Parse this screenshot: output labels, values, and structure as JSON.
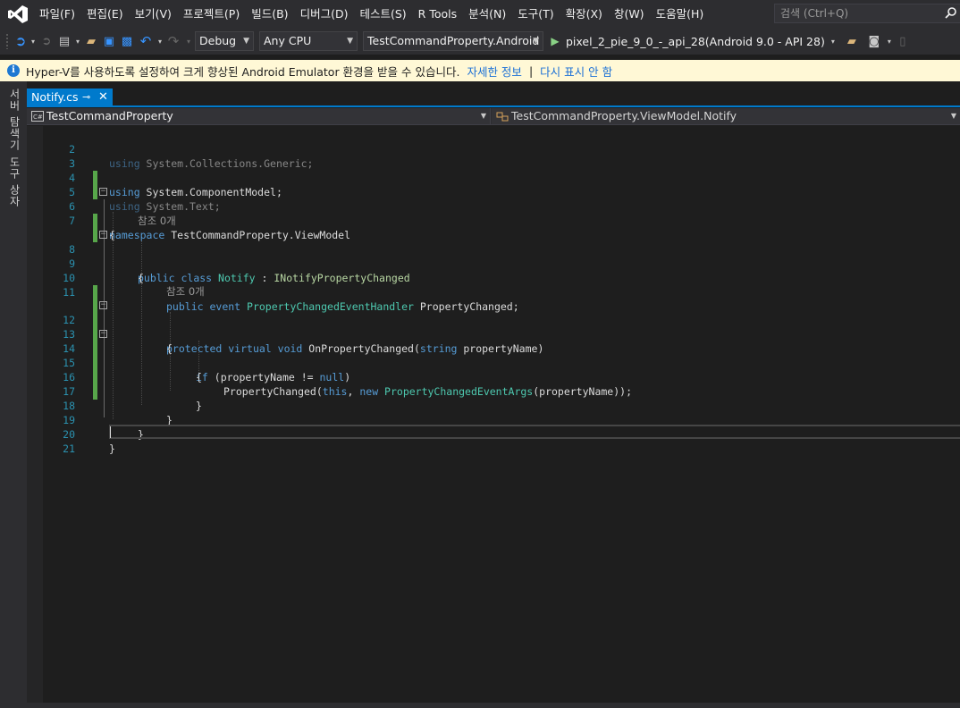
{
  "menu": {
    "items": [
      "파일(F)",
      "편집(E)",
      "보기(V)",
      "프로젝트(P)",
      "빌드(B)",
      "디버그(D)",
      "테스트(S)",
      "R Tools",
      "분석(N)",
      "도구(T)",
      "확장(X)",
      "창(W)",
      "도움말(H)"
    ],
    "search_placeholder": "검색 (Ctrl+Q)"
  },
  "toolbar": {
    "configuration": "Debug",
    "platform": "Any CPU",
    "startup_project": "TestCommandProperty.Android",
    "run_target": "pixel_2_pie_9_0_-_api_28(Android 9.0 - API 28)"
  },
  "infobar": {
    "message": "Hyper-V를 사용하도록 설정하여 크게 향상된 Android Emulator 환경을 받을 수 있습니다.",
    "link_more": "자세한 정보",
    "separator": "|",
    "link_dismiss": "다시 표시 안 함"
  },
  "left_strip": {
    "server_explorer": "서버 탐색기",
    "toolbox": "도구 상자"
  },
  "tab": {
    "title": "Notify.cs",
    "pin": "⊸",
    "close": "✕"
  },
  "navbar": {
    "project": "TestCommandProperty",
    "member": "TestCommandProperty.ViewModel.Notify"
  },
  "code": {
    "ln": [
      "2",
      "3",
      "4",
      "5",
      "6",
      "7",
      "8",
      "9",
      "10",
      "11",
      "12",
      "13",
      "14",
      "15",
      "16",
      "17",
      "18",
      "19",
      "20",
      "21"
    ],
    "l2": [
      "using ",
      "System.Collections.Generic;"
    ],
    "l3": [
      "using ",
      "System.ComponentModel;"
    ],
    "l4": [
      "using ",
      "System.Text;"
    ],
    "l6": [
      "namespace ",
      "TestCommandProperty.ViewModel"
    ],
    "l7": "{",
    "lens1": "참조 0개",
    "l8": [
      "public ",
      "class ",
      "Notify",
      " : ",
      "INotifyPropertyChanged"
    ],
    "l9": "{",
    "l10": [
      "public ",
      "event ",
      "PropertyChangedEventHandler",
      " PropertyChanged;"
    ],
    "lens2": "참조 0개",
    "l12": [
      "protected ",
      "virtual ",
      "void ",
      "OnPropertyChanged(",
      "string ",
      "propertyName)"
    ],
    "l13": "{",
    "l14": [
      "if ",
      "(propertyName != ",
      "null",
      ")"
    ],
    "l15": "{",
    "l16": [
      "PropertyChanged(",
      "this",
      ", ",
      "new ",
      "PropertyChangedEventArgs",
      "(propertyName));"
    ],
    "l17": "}",
    "l18": "}",
    "l19": "}",
    "l20": "}"
  },
  "colors": {
    "keyword": "#569cd6",
    "type": "#4ec9b0",
    "interface": "#b8d7a3",
    "line_number": "#2b91af",
    "accent": "#007acc",
    "change_marker": "#57a64a"
  }
}
